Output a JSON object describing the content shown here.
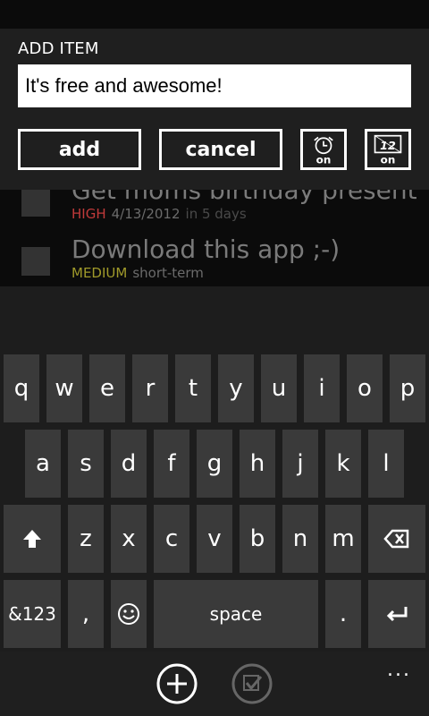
{
  "tasks": [
    {
      "title": "Get moms birthday present",
      "priority": "HIGH",
      "priority_color": "#c13a3a",
      "date": "4/13/2012",
      "relative": "in 5 days"
    },
    {
      "title": "Download this app ;-)",
      "priority": "MEDIUM",
      "priority_color": "#a09a2a",
      "date": "short-term",
      "relative": ""
    }
  ],
  "dialog": {
    "heading": "ADD ITEM",
    "input_value": "It's free and awesome!",
    "add_label": "add",
    "cancel_label": "cancel",
    "alarm_icon": "alarm-on-icon",
    "clock_icon": "clock-12-on-icon",
    "alarm_badge": "on",
    "clock_badge": "on",
    "clock_number": "12"
  },
  "keyboard": {
    "row1": [
      "q",
      "w",
      "e",
      "r",
      "t",
      "y",
      "u",
      "i",
      "o",
      "p"
    ],
    "row2": [
      "a",
      "s",
      "d",
      "f",
      "g",
      "h",
      "j",
      "k",
      "l"
    ],
    "row3": [
      "z",
      "x",
      "c",
      "v",
      "b",
      "n",
      "m"
    ],
    "symbols_label": "&123",
    "comma_label": ",",
    "space_label": "space",
    "period_label": "."
  },
  "appbar": {
    "more_label": "...",
    "add_icon": "plus-circle-icon",
    "check_icon": "check-circle-icon"
  }
}
